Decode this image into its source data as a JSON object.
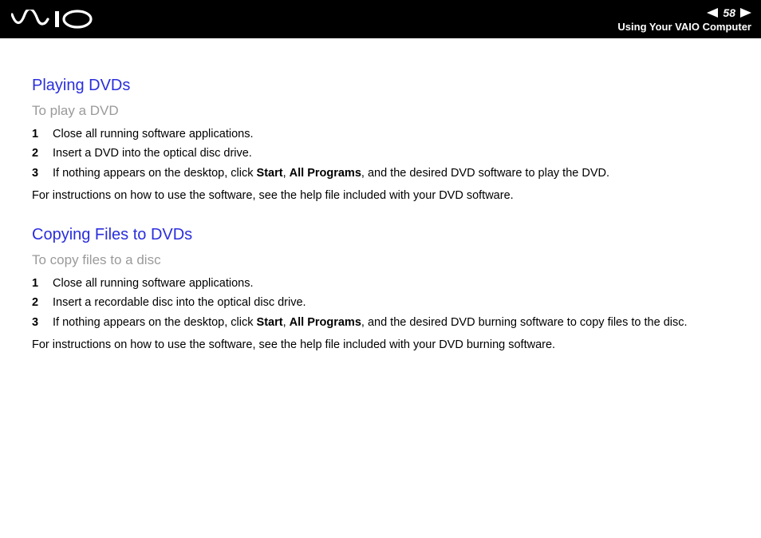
{
  "header": {
    "page_number": "58",
    "section": "Using Your VAIO Computer"
  },
  "section1": {
    "title": "Playing DVDs",
    "subtitle": "To play a DVD",
    "steps": [
      {
        "n": "1",
        "text": "Close all running software applications."
      },
      {
        "n": "2",
        "text": "Insert a DVD into the optical disc drive."
      },
      {
        "n": "3",
        "pre": "If nothing appears on the desktop, click ",
        "b1": "Start",
        "mid": ", ",
        "b2": "All Programs",
        "post": ", and the desired DVD software to play the DVD."
      }
    ],
    "after": "For instructions on how to use the software, see the help file included with your DVD software."
  },
  "section2": {
    "title": "Copying Files to DVDs",
    "subtitle": "To copy files to a disc",
    "steps": [
      {
        "n": "1",
        "text": "Close all running software applications."
      },
      {
        "n": "2",
        "text": "Insert a recordable disc into the optical disc drive."
      },
      {
        "n": "3",
        "pre": "If nothing appears on the desktop, click ",
        "b1": "Start",
        "mid": ", ",
        "b2": "All Programs",
        "post": ", and the desired DVD burning software to copy files to the disc."
      }
    ],
    "after": "For instructions on how to use the software, see the help file included with your DVD burning software."
  }
}
